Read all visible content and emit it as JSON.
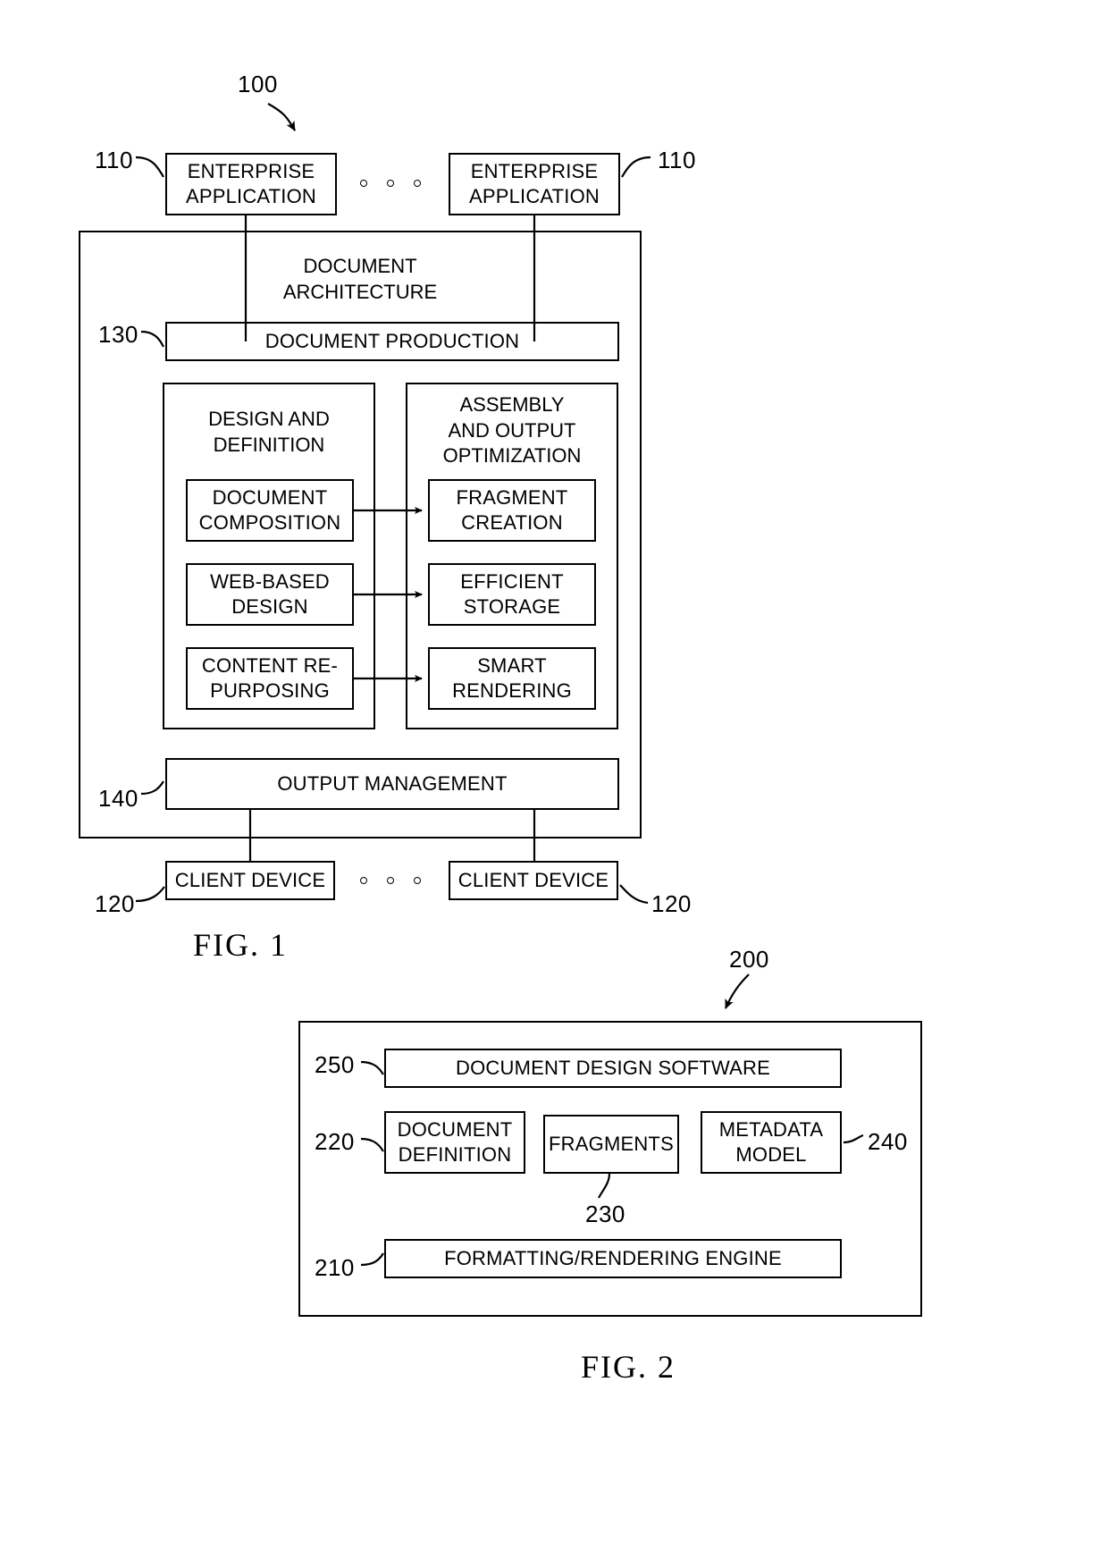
{
  "figures": [
    {
      "id": "fig1",
      "caption": "FIG. 1",
      "system_ref": "100",
      "refs": {
        "enterprise_app": "110",
        "client_device": "120",
        "document_production": "130",
        "output_management": "140"
      },
      "enterprise_app_left": "ENTERPRISE\nAPPLICATION",
      "enterprise_app_right": "ENTERPRISE\nAPPLICATION",
      "architecture_title": "DOCUMENT\nARCHITECTURE",
      "document_production": "DOCUMENT PRODUCTION",
      "design_panel_title": "DESIGN AND\nDEFINITION",
      "assembly_panel_title": "ASSEMBLY\nAND OUTPUT\nOPTIMIZATION",
      "design_items": [
        "DOCUMENT\nCOMPOSITION",
        "WEB-BASED\nDESIGN",
        "CONTENT\nRE-PURPOSING"
      ],
      "assembly_items": [
        "FRAGMENT\nCREATION",
        "EFFICIENT\nSTORAGE",
        "SMART\nRENDERING"
      ],
      "output_management": "OUTPUT MANAGEMENT",
      "client_device_left": "CLIENT DEVICE",
      "client_device_right": "CLIENT DEVICE"
    },
    {
      "id": "fig2",
      "caption": "FIG. 2",
      "system_ref": "200",
      "refs": {
        "design_software": "250",
        "document_definition": "220",
        "fragments": "230",
        "metadata_model": "240",
        "rendering_engine": "210"
      },
      "design_software": "DOCUMENT DESIGN SOFTWARE",
      "document_definition": "DOCUMENT\nDEFINITION",
      "fragments": "FRAGMENTS",
      "metadata_model": "METADATA\nMODEL",
      "rendering_engine": "FORMATTING/RENDERING ENGINE"
    }
  ],
  "colors": {
    "ink": "#000000",
    "paper": "#ffffff"
  }
}
